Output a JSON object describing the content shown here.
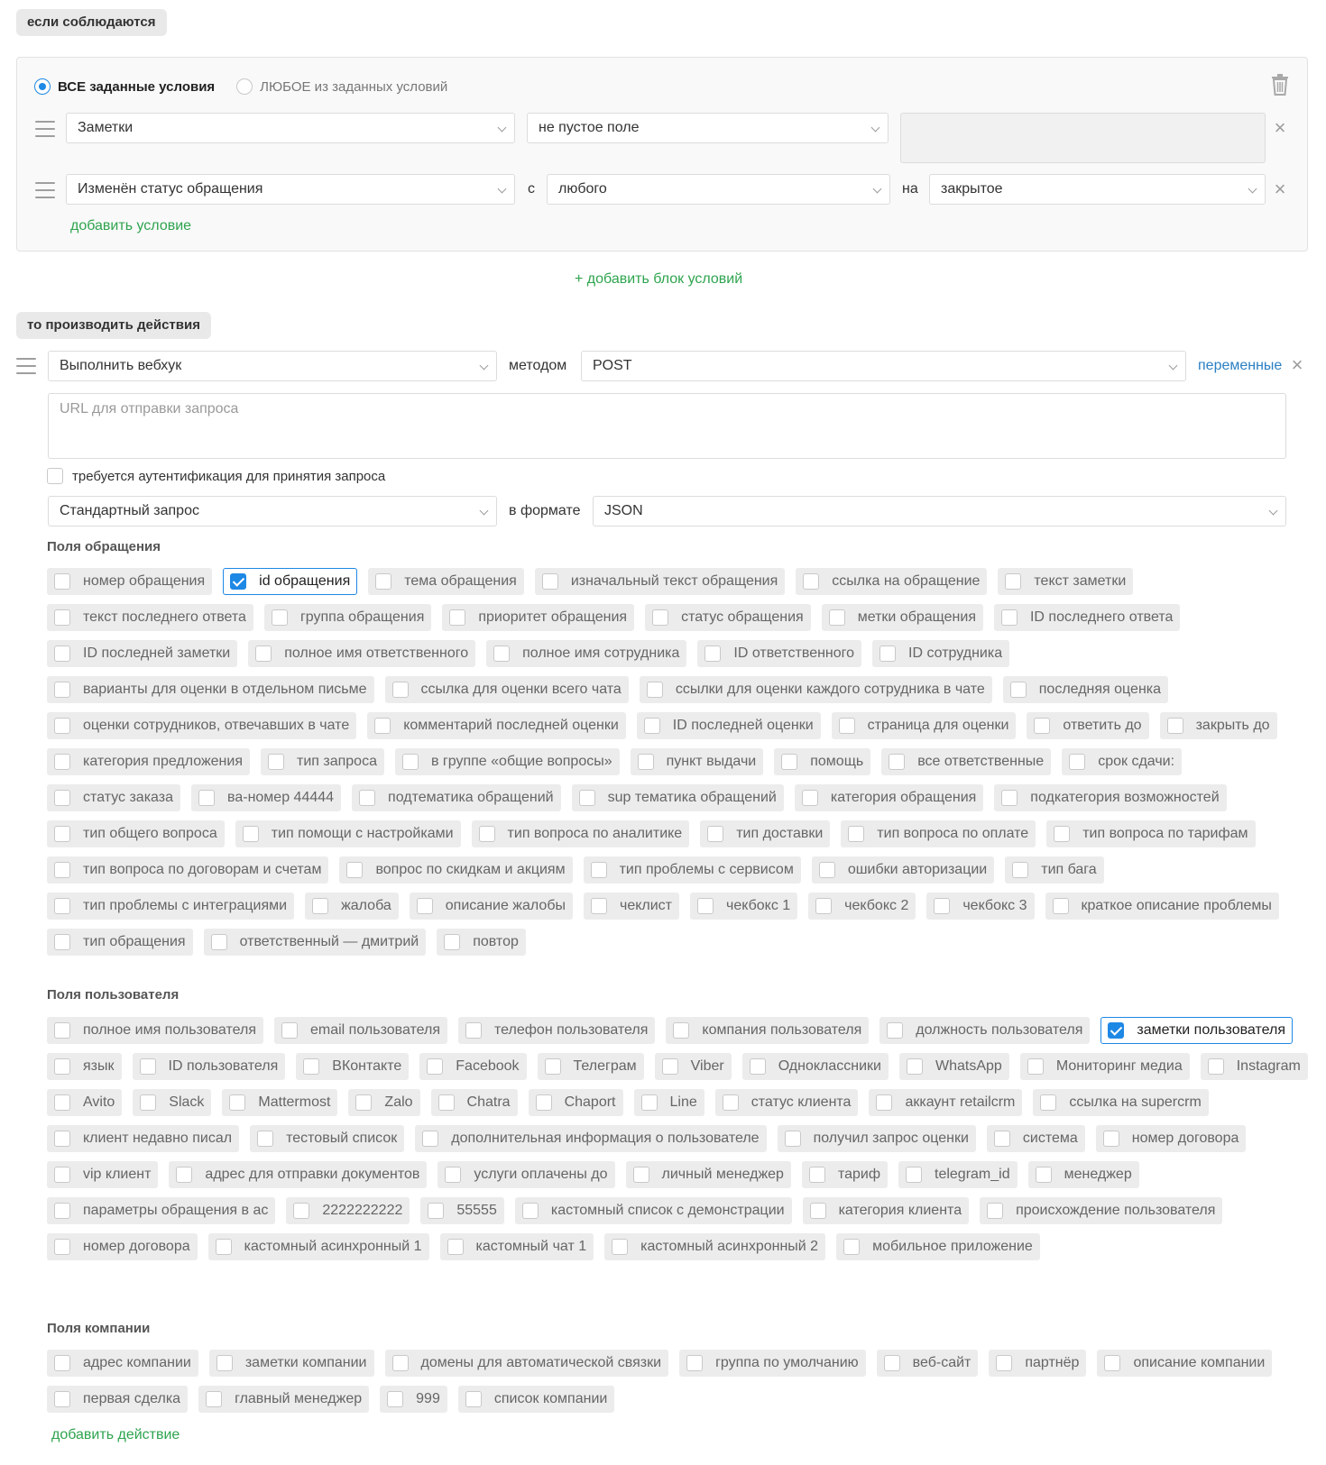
{
  "if_section": {
    "label": "если соблюдаются",
    "match_all": "ВСЕ заданные условия",
    "match_any": "ЛЮБОЕ из заданных условий",
    "conditions": [
      {
        "field": "Заметки",
        "operator": "не пустое поле",
        "value": ""
      },
      {
        "field": "Изменён статус обращения",
        "from_label": "с",
        "from": "любого",
        "to_label": "на",
        "to": "закрытое"
      }
    ],
    "add_condition": "добавить условие"
  },
  "add_block": "+ добавить блок условий",
  "then_section": {
    "label": "то производить действия",
    "action": "Выполнить вебхук",
    "method_label": "методом",
    "method": "POST",
    "variables_link": "переменные",
    "url_placeholder": "URL для отправки запроса",
    "auth_label": "требуется аутентификация для принятия запроса",
    "request_type": "Стандартный запрос",
    "format_label": "в формате",
    "format": "JSON",
    "add_action": "добавить действие"
  },
  "groups": [
    {
      "title": "Поля обращения",
      "fields": [
        {
          "label": "номер обращения",
          "checked": false
        },
        {
          "label": "id обращения",
          "checked": true
        },
        {
          "label": "тема обращения",
          "checked": false
        },
        {
          "label": "изначальный текст обращения",
          "checked": false
        },
        {
          "label": "ссылка на обращение",
          "checked": false
        },
        {
          "label": "текст заметки",
          "checked": false
        },
        {
          "label": "текст последнего ответа",
          "checked": false
        },
        {
          "label": "группа обращения",
          "checked": false
        },
        {
          "label": "приоритет обращения",
          "checked": false
        },
        {
          "label": "статус обращения",
          "checked": false
        },
        {
          "label": "метки обращения",
          "checked": false
        },
        {
          "label": "ID последнего ответа",
          "checked": false
        },
        {
          "label": "ID последней заметки",
          "checked": false
        },
        {
          "label": "полное имя ответственного",
          "checked": false
        },
        {
          "label": "полное имя сотрудника",
          "checked": false
        },
        {
          "label": "ID ответственного",
          "checked": false
        },
        {
          "label": "ID сотрудника",
          "checked": false
        },
        {
          "label": "варианты для оценки в отдельном письме",
          "checked": false
        },
        {
          "label": "ссылка для оценки всего чата",
          "checked": false
        },
        {
          "label": "ссылки для оценки каждого сотрудника в чате",
          "checked": false
        },
        {
          "label": "последняя оценка",
          "checked": false
        },
        {
          "label": "оценки сотрудников, отвечавших в чате",
          "checked": false
        },
        {
          "label": "комментарий последней оценки",
          "checked": false
        },
        {
          "label": "ID последней оценки",
          "checked": false
        },
        {
          "label": "страница для оценки",
          "checked": false
        },
        {
          "label": "ответить до",
          "checked": false
        },
        {
          "label": "закрыть до",
          "checked": false
        },
        {
          "label": "категория предложения",
          "checked": false
        },
        {
          "label": "тип запроса",
          "checked": false
        },
        {
          "label": "в группе «общие вопросы»",
          "checked": false
        },
        {
          "label": "пункт выдачи",
          "checked": false
        },
        {
          "label": "помощь",
          "checked": false
        },
        {
          "label": "все ответственные",
          "checked": false
        },
        {
          "label": "срок сдачи:",
          "checked": false
        },
        {
          "label": "статус заказа",
          "checked": false
        },
        {
          "label": "ва-номер 44444",
          "checked": false
        },
        {
          "label": "подтематика обращений",
          "checked": false
        },
        {
          "label": "sup тематика обращений",
          "checked": false
        },
        {
          "label": "категория обращения",
          "checked": false
        },
        {
          "label": "подкатегория возможностей",
          "checked": false
        },
        {
          "label": "тип общего вопроса",
          "checked": false
        },
        {
          "label": "тип помощи с настройками",
          "checked": false
        },
        {
          "label": "тип вопроса по аналитике",
          "checked": false
        },
        {
          "label": "тип доставки",
          "checked": false
        },
        {
          "label": "тип вопроса по оплате",
          "checked": false
        },
        {
          "label": "тип вопроса по тарифам",
          "checked": false
        },
        {
          "label": "тип вопроса по договорам и счетам",
          "checked": false
        },
        {
          "label": "вопрос по скидкам и акциям",
          "checked": false
        },
        {
          "label": "тип проблемы с сервисом",
          "checked": false
        },
        {
          "label": "ошибки авторизации",
          "checked": false
        },
        {
          "label": "тип бага",
          "checked": false
        },
        {
          "label": "тип проблемы с интеграциями",
          "checked": false
        },
        {
          "label": "жалоба",
          "checked": false
        },
        {
          "label": "описание жалобы",
          "checked": false
        },
        {
          "label": "чеклист",
          "checked": false
        },
        {
          "label": "чекбокс 1",
          "checked": false
        },
        {
          "label": "чекбокс 2",
          "checked": false
        },
        {
          "label": "чекбокс 3",
          "checked": false
        },
        {
          "label": "краткое описание проблемы",
          "checked": false
        },
        {
          "label": "тип обращения",
          "checked": false
        },
        {
          "label": "ответственный — дмитрий",
          "checked": false
        },
        {
          "label": "повтор",
          "checked": false
        }
      ]
    },
    {
      "title": "Поля пользователя",
      "fields": [
        {
          "label": "полное имя пользователя",
          "checked": false
        },
        {
          "label": "email пользователя",
          "checked": false
        },
        {
          "label": "телефон пользователя",
          "checked": false
        },
        {
          "label": "компания пользователя",
          "checked": false
        },
        {
          "label": "должность пользователя",
          "checked": false
        },
        {
          "label": "заметки пользователя",
          "checked": true
        },
        {
          "label": "язык",
          "checked": false
        },
        {
          "label": "ID пользователя",
          "checked": false
        },
        {
          "label": "ВКонтакте",
          "checked": false
        },
        {
          "label": "Facebook",
          "checked": false
        },
        {
          "label": "Телеграм",
          "checked": false
        },
        {
          "label": "Viber",
          "checked": false
        },
        {
          "label": "Одноклассники",
          "checked": false
        },
        {
          "label": "WhatsApp",
          "checked": false
        },
        {
          "label": "Мониторинг медиа",
          "checked": false
        },
        {
          "label": "Instagram",
          "checked": false
        },
        {
          "label": "Avito",
          "checked": false
        },
        {
          "label": "Slack",
          "checked": false
        },
        {
          "label": "Mattermost",
          "checked": false
        },
        {
          "label": "Zalo",
          "checked": false
        },
        {
          "label": "Chatra",
          "checked": false
        },
        {
          "label": "Chaport",
          "checked": false
        },
        {
          "label": "Line",
          "checked": false
        },
        {
          "label": "статус клиента",
          "checked": false
        },
        {
          "label": "аккаунт retailcrm",
          "checked": false
        },
        {
          "label": "ссылка на supercrm",
          "checked": false
        },
        {
          "label": "клиент недавно писал",
          "checked": false
        },
        {
          "label": "тестовый список",
          "checked": false
        },
        {
          "label": "дополнительная информация о пользователе",
          "checked": false
        },
        {
          "label": "получил запрос оценки",
          "checked": false
        },
        {
          "label": "система",
          "checked": false
        },
        {
          "label": "номер договора",
          "checked": false
        },
        {
          "label": "vip клиент",
          "checked": false
        },
        {
          "label": "адрес для отправки документов",
          "checked": false
        },
        {
          "label": "услуги оплачены до",
          "checked": false
        },
        {
          "label": "личный менеджер",
          "checked": false
        },
        {
          "label": "тариф",
          "checked": false
        },
        {
          "label": "telegram_id",
          "checked": false
        },
        {
          "label": "менеджер",
          "checked": false
        },
        {
          "label": "параметры обращения в ас",
          "checked": false
        },
        {
          "label": "2222222222",
          "checked": false
        },
        {
          "label": "55555",
          "checked": false
        },
        {
          "label": "кастомный список с демонстрации",
          "checked": false
        },
        {
          "label": "категория клиента",
          "checked": false
        },
        {
          "label": "происхождение пользователя",
          "checked": false
        },
        {
          "label": "номер договора",
          "checked": false
        },
        {
          "label": "кастомный асинхронный 1",
          "checked": false
        },
        {
          "label": "кастомный чат 1",
          "checked": false
        },
        {
          "label": "кастомный асинхронный 2",
          "checked": false
        },
        {
          "label": "мобильное приложение",
          "checked": false
        }
      ]
    },
    {
      "title": "Поля компании",
      "fields": [
        {
          "label": "адрес компании",
          "checked": false
        },
        {
          "label": "заметки компании",
          "checked": false
        },
        {
          "label": "домены для автоматической связки",
          "checked": false
        },
        {
          "label": "группа по умолчанию",
          "checked": false
        },
        {
          "label": "веб-сайт",
          "checked": false
        },
        {
          "label": "партнёр",
          "checked": false
        },
        {
          "label": "описание компании",
          "checked": false
        },
        {
          "label": "первая сделка",
          "checked": false
        },
        {
          "label": "главный менеджер",
          "checked": false
        },
        {
          "label": "999",
          "checked": false
        },
        {
          "label": "список компании",
          "checked": false
        }
      ]
    }
  ],
  "icons": {
    "trash": "trash-icon",
    "drag": "drag-handle-icon",
    "remove": "close-icon",
    "dropdown": "chevron-down-icon"
  },
  "colors": {
    "accent": "#1e88e5",
    "link_green": "#2ea44f",
    "link_blue": "#2b7fc3",
    "chip_bg": "#ececec"
  }
}
